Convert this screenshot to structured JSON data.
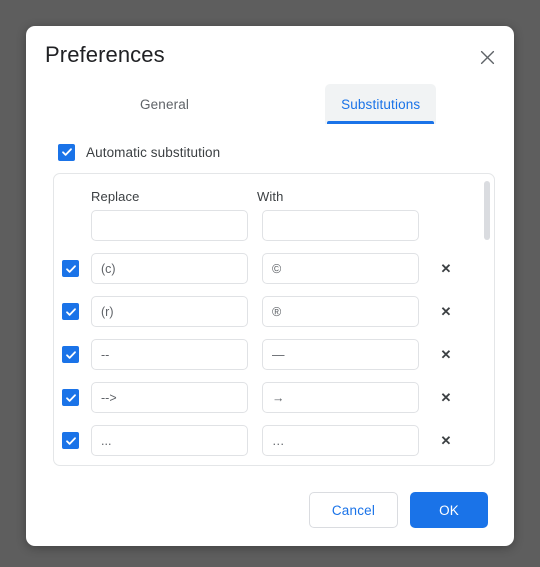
{
  "dialog": {
    "title": "Preferences",
    "close_icon": "close-icon"
  },
  "tabs": [
    {
      "label": "General",
      "selected": false
    },
    {
      "label": "Substitutions",
      "selected": true
    }
  ],
  "auto_substitution": {
    "label": "Automatic substitution",
    "checked": true
  },
  "table": {
    "columns": [
      "Replace",
      "With"
    ],
    "new_row": {
      "replace": "",
      "with": "",
      "replace_placeholder": "",
      "with_placeholder": ""
    },
    "rows": [
      {
        "checked": true,
        "replace": "(c)",
        "with": "©",
        "delete_icon": "close-icon"
      },
      {
        "checked": true,
        "replace": "(r)",
        "with": "®",
        "delete_icon": "close-icon"
      },
      {
        "checked": true,
        "replace": "--",
        "with": "—",
        "delete_icon": "close-icon"
      },
      {
        "checked": true,
        "replace": "-->",
        "with": "→",
        "delete_icon": "close-icon"
      },
      {
        "checked": true,
        "replace": "...",
        "with": "…",
        "delete_icon": "close-icon"
      },
      {
        "checked": true,
        "replace": "",
        "with": "",
        "delete_icon": "close-icon"
      }
    ]
  },
  "footer": {
    "cancel_label": "Cancel",
    "ok_label": "OK"
  },
  "colors": {
    "accent": "#1a73e8",
    "backdrop": "#5e5e5e",
    "surface": "#ffffff",
    "text_primary": "#202124",
    "text_secondary": "#5f6368",
    "border": "#e0e2e5",
    "tab_active_bg": "#f1f3f4",
    "scrollbar_thumb": "#dadce0"
  }
}
